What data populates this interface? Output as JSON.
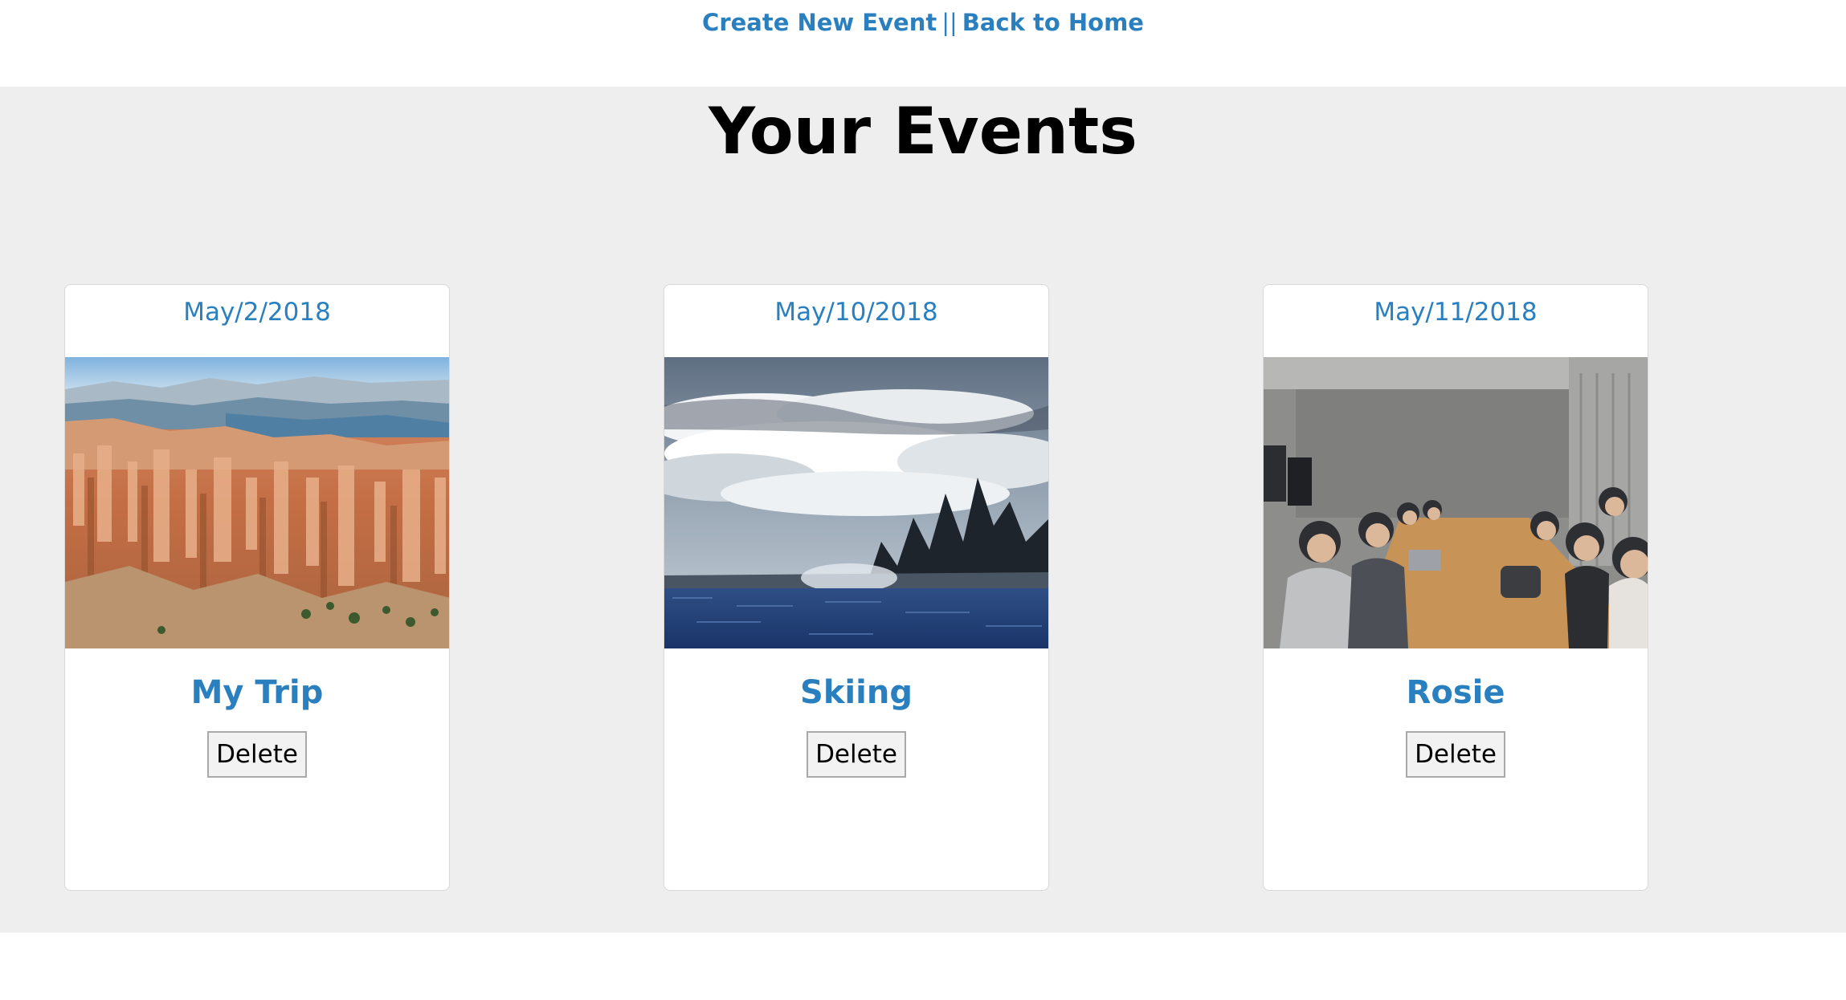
{
  "nav": {
    "create_label": "Create New Event",
    "separator": "||",
    "home_label": "Back to Home",
    "link_color": "#2a80bf"
  },
  "page": {
    "title": "Your Events",
    "section_background": "#eeeeee"
  },
  "events": [
    {
      "date": "May/2/2018",
      "name": "My Trip",
      "delete_label": "Delete",
      "image": "canyon-hoodoos-photo"
    },
    {
      "date": "May/10/2018",
      "name": "Skiing",
      "delete_label": "Delete",
      "image": "clouds-over-lake-photo"
    },
    {
      "date": "May/11/2018",
      "name": "Rosie",
      "delete_label": "Delete",
      "image": "group-meeting-photo"
    }
  ]
}
